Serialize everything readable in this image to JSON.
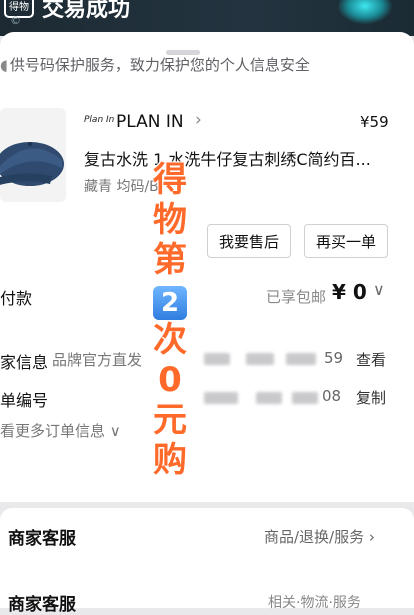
{
  "header": {
    "logo_text": "得物",
    "title": "交易成功",
    "copyright": "©"
  },
  "privacy_notice": "供号码保护服务，致力保护您的个人信息安全",
  "product": {
    "brand_mark": "Plan In",
    "brand_name": "PLAN IN",
    "price": "¥59",
    "title": "复古水洗 1 水洗牛仔复古刺绣C简约百...",
    "spec": "藏青 均码/B",
    "actions": [
      "我要售后",
      "再买一单"
    ]
  },
  "payment": {
    "label": "付款",
    "note": "已享包邮",
    "amount": "¥ 0"
  },
  "shipping": {
    "label": "家信息",
    "value": "品牌官方直发",
    "tail": "59",
    "link": "查看"
  },
  "order": {
    "label": "单编号",
    "tail": "08",
    "link": "复制"
  },
  "more_info": "看更多订单信息",
  "customer_service": {
    "label": "商家客服",
    "right": "商品/退换/服务"
  },
  "bottom_row": {
    "label": "商家客服",
    "right": "相关·物流·服务"
  },
  "overlay": {
    "chars": [
      "得",
      "物",
      "第",
      "2",
      "次",
      "0",
      "元",
      "购"
    ]
  },
  "colors": {
    "overlay": "#ff6a2a",
    "badge": "#2f7de0"
  }
}
